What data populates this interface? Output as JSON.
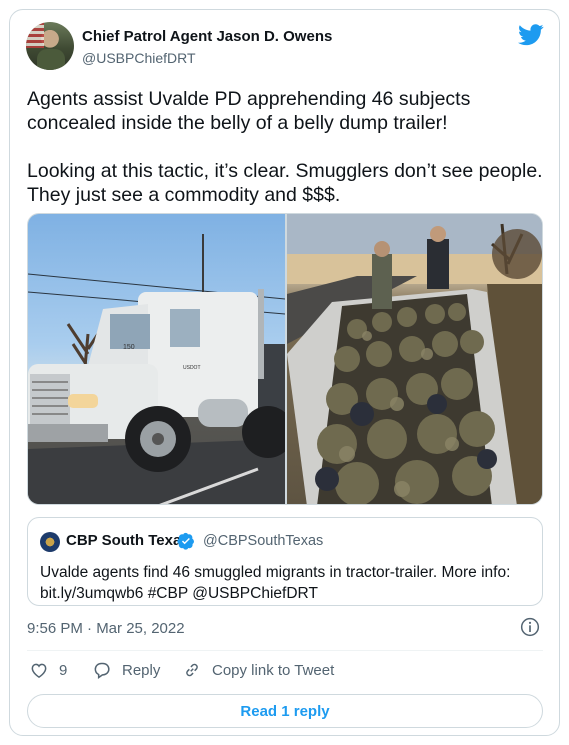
{
  "author": {
    "name": "Chief Patrol Agent Jason D. Owens",
    "handle": "@USBPChiefDRT",
    "avatar_icon": "profile-photo"
  },
  "brand_icon": "twitter-bird-icon",
  "colors": {
    "accent": "#1d9bf0",
    "text": "#0f1419",
    "muted": "#536471",
    "border": "#cfd9de"
  },
  "tweet": {
    "line1": "Agents assist Uvalde PD apprehending 46 subjects concealed inside the belly of a belly dump trailer!",
    "line2": "Looking at this tactic, it’s clear. Smugglers don’t see people. They just see a commodity and $$$."
  },
  "media": {
    "truck_text_1": "150",
    "truck_text_2": "USDOT"
  },
  "quoted_tweet": {
    "name": "CBP South Texas",
    "handle": "@CBPSouthTexas",
    "text": "Uvalde agents find 46 smuggled migrants in tractor-trailer. More info: bit.ly/3umqwb6 #CBP @USBPChiefDRT"
  },
  "timestamp": "9:56 PM · Mar 25, 2022",
  "actions": {
    "like_count": "9",
    "reply_label": "Reply",
    "copy_label": "Copy link to Tweet"
  },
  "read_reply_label": "Read 1 reply"
}
